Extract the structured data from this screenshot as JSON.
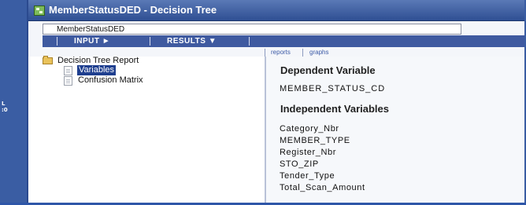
{
  "window": {
    "title": "MemberStatusDED - Decision Tree",
    "name_field": "MemberStatusDED"
  },
  "left_edge": {
    "text_line1": "L",
    "text_line2": ":0"
  },
  "menubar": {
    "input_label": "INPUT ►",
    "results_label": "RESULTS ▼"
  },
  "subtabs": {
    "reports": "reports",
    "graphs": "graphs"
  },
  "tree": {
    "root_label": "Decision Tree Report",
    "items": [
      {
        "label": "Variables",
        "selected": true
      },
      {
        "label": "Confusion Matrix",
        "selected": false
      }
    ]
  },
  "content": {
    "dependent_heading": "Dependent Variable",
    "dependent_value": "MEMBER_STATUS_CD",
    "independent_heading": "Independent Variables",
    "independent_values": [
      "Category_Nbr",
      "MEMBER_TYPE",
      "Register_Nbr",
      "STO_ZIP",
      "Tender_Type",
      "Total_Scan_Amount"
    ]
  },
  "colors": {
    "titlebar": "#2f4f93",
    "menubar": "#3f5aa0",
    "selection": "#1f3f8f",
    "frame": "#3a5da3"
  },
  "icons": {
    "app": "decision-tree-icon",
    "root": "folder-icon",
    "leaf": "document-icon",
    "input_arrow": "arrow-right-icon",
    "results_arrow": "arrow-down-icon"
  }
}
